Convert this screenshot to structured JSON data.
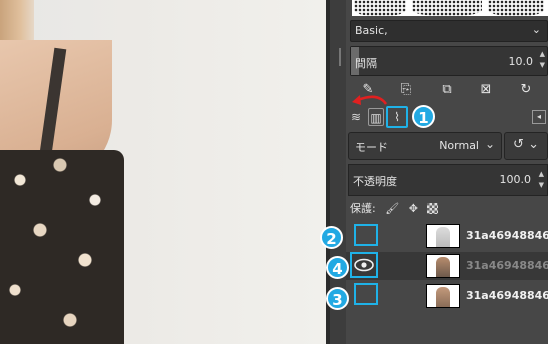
{
  "brush_panel": {
    "preset_value": "Basic,",
    "spacing_label": "間隔",
    "spacing_value": "10.0",
    "tools": [
      "edit-brush-icon",
      "duplicate-brush-icon",
      "copy-location-icon",
      "delete-brush-icon",
      "refresh-icon"
    ]
  },
  "dock_tabs": {
    "tabs": [
      "layers-tab-icon",
      "channels-tab-icon",
      "paths-tab-icon"
    ],
    "menu_icon": "tab-menu-icon"
  },
  "layers_panel": {
    "mode_label": "モード",
    "mode_value": "Normal",
    "opacity_label": "不透明度",
    "opacity_value": "100.0",
    "lock_label": "保護:",
    "lock_icons": [
      "lock-pixels-icon",
      "lock-position-icon",
      "lock-alpha-icon"
    ],
    "layers": [
      {
        "name": "31a46948846c",
        "visible": false,
        "callout": "2"
      },
      {
        "name": "31a46948846c",
        "visible": true,
        "callout": "4"
      },
      {
        "name": "31a46948846c",
        "visible": false,
        "callout": "3"
      }
    ]
  },
  "annotations": {
    "tab_callout": "1",
    "accent_color": "#22a9e3",
    "arrow_color": "#e02020"
  }
}
